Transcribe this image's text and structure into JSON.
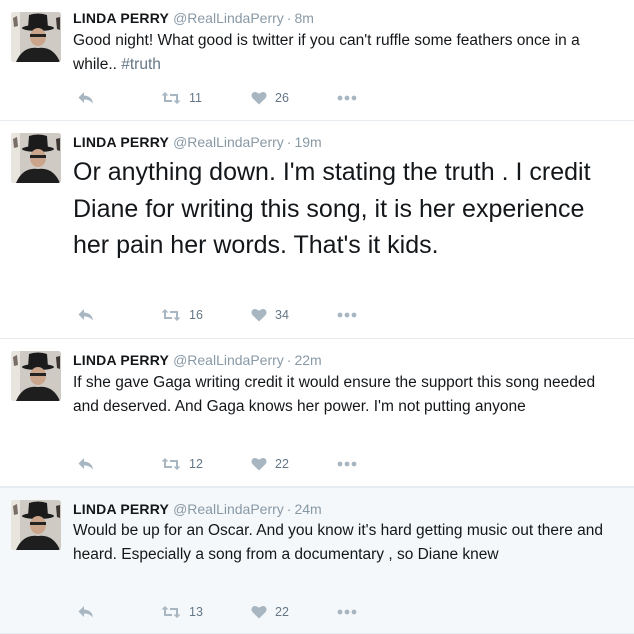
{
  "colors": {
    "name": "#14171a",
    "meta": "#8899a6",
    "icon": "#a8b6c2",
    "divider": "#e6ecf0"
  },
  "icons": {
    "reply": "reply-icon",
    "retweet": "retweet-icon",
    "like": "heart-icon",
    "more": "more-dots-icon"
  },
  "tweets": [
    {
      "name": "LINDA PERRY",
      "handle": "@RealLindaPerry",
      "separator": "·",
      "time": "8m",
      "text_main": "Good night! What good is twitter if you can't ruffle some feathers once in a while.. ",
      "hashtag": "#truth",
      "retweets": "11",
      "likes": "26"
    },
    {
      "name": "LINDA PERRY",
      "handle": "@RealLindaPerry",
      "separator": "·",
      "time": "19m",
      "text": "Or anything down. I'm stating the truth . I credit Diane for writing this song,  it is her experience her pain her words. That's it kids.",
      "retweets": "16",
      "likes": "34"
    },
    {
      "name": "LINDA PERRY",
      "handle": "@RealLindaPerry",
      "separator": "·",
      "time": "22m",
      "text": "If she gave Gaga writing credit it would ensure the support this song needed and deserved. And Gaga knows her power. I'm not putting anyone",
      "retweets": "12",
      "likes": "22"
    },
    {
      "name": "LINDA PERRY",
      "handle": "@RealLindaPerry",
      "separator": "·",
      "time": "24m",
      "text": "Would be up for an Oscar. And you know it's hard getting music out there and heard. Especially a song from a documentary , so Diane knew",
      "retweets": "13",
      "likes": "22"
    }
  ]
}
